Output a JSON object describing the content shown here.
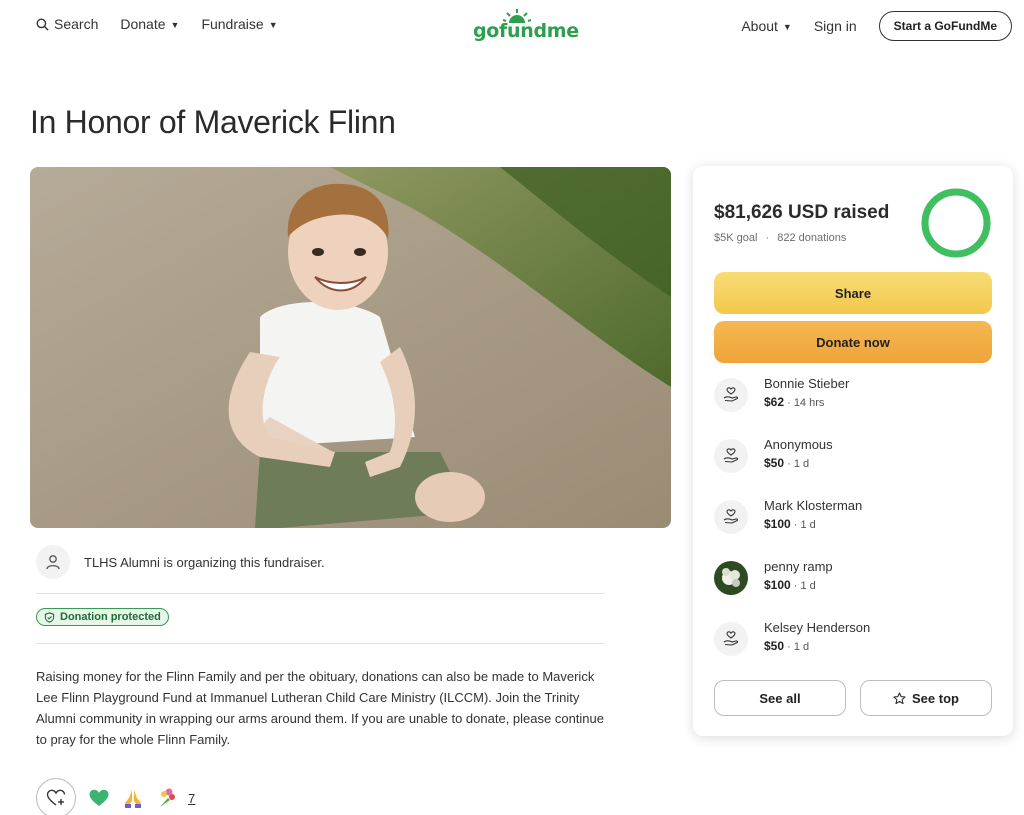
{
  "nav": {
    "search_label": "Search",
    "donate_label": "Donate",
    "fundraise_label": "Fundraise",
    "logo_text": "gofundme",
    "about_label": "About",
    "signin_label": "Sign in",
    "start_label": "Start a GoFundMe"
  },
  "page": {
    "title": "In Honor of Maverick Flinn",
    "organizer_text": "TLHS Alumni is organizing this fundraiser.",
    "badge_label": "Donation protected",
    "story": "Raising money for the Flinn Family and per the obituary, donations can also be made to Maverick Lee Flinn Playground Fund at Immanuel Lutheran Child Care Ministry (ILCCM). Join the Trinity Alumni community in wrapping our arms around them. If you are unable to donate, please continue to pray for the whole Flinn Family.",
    "reaction_count": "7"
  },
  "card": {
    "raised_text": "$81,626 USD raised",
    "goal_text": "$5K goal",
    "separator": "·",
    "donations_text": "822 donations",
    "progress_fraction": 1.0,
    "share_label": "Share",
    "donate_label": "Donate now",
    "see_all_label": "See all",
    "see_top_label": "See top",
    "donors": [
      {
        "name": "Bonnie Stieber",
        "amount": "$62",
        "time": "14 hrs"
      },
      {
        "name": "Anonymous",
        "amount": "$50",
        "time": "1 d"
      },
      {
        "name": "Mark Klosterman",
        "amount": "$100",
        "time": "1 d"
      },
      {
        "name": "penny ramp",
        "amount": "$100",
        "time": "1 d"
      },
      {
        "name": "Kelsey Henderson",
        "amount": "$50",
        "time": "1 d"
      }
    ],
    "donor_separator": " · "
  },
  "colors": {
    "brand_green": "#2e9e4f",
    "share_yellow": "#f2c74c",
    "donate_orange": "#eea43a",
    "progress_green": "#3fbf5f"
  }
}
